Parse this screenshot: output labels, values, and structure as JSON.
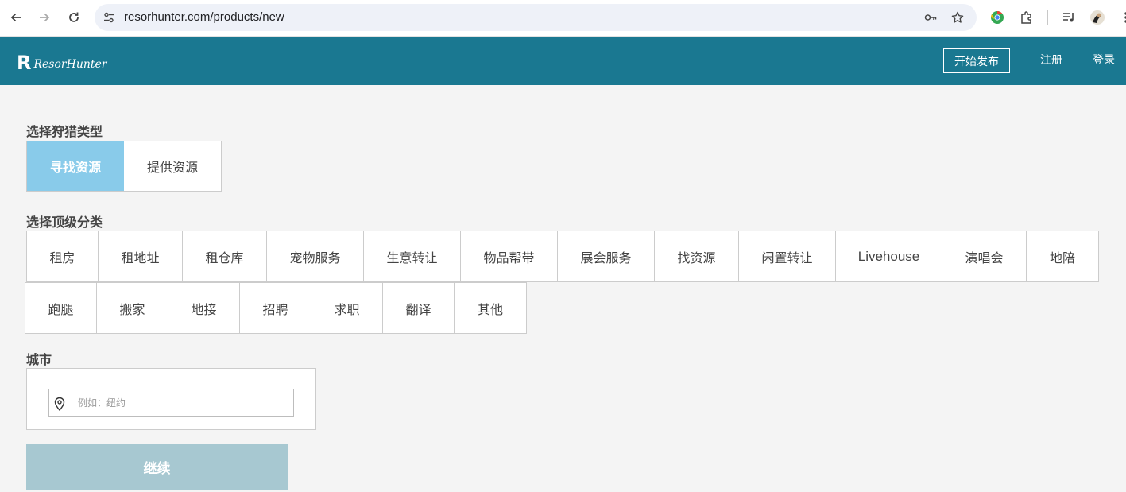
{
  "browser": {
    "url": "resorhunter.com/products/new"
  },
  "header": {
    "logo_mark": "R",
    "logo_text": "ResorHunter",
    "publish_label": "开始发布",
    "register_label": "注册",
    "login_label": "登录"
  },
  "hunt_type": {
    "title": "选择狩猎类型",
    "options": [
      "寻找资源",
      "提供资源"
    ],
    "selected": "寻找资源"
  },
  "category": {
    "title": "选择顶级分类",
    "row1": [
      "租房",
      "租地址",
      "租仓库",
      "宠物服务",
      "生意转让",
      "物品帮带",
      "展会服务",
      "找资源",
      "闲置转让",
      "Livehouse",
      "演唱会",
      "地陪"
    ],
    "row2": [
      "跑腿",
      "搬家",
      "地接",
      "招聘",
      "求职",
      "翻译",
      "其他"
    ]
  },
  "city": {
    "title": "城市",
    "value": "",
    "placeholder": "例如：纽约"
  },
  "continue_label": "继续",
  "colors": {
    "header_bg": "#1a7891",
    "active_toggle": "#89cbea",
    "continue_bg": "#a7c8d1",
    "page_bg": "#f4f4f4"
  }
}
